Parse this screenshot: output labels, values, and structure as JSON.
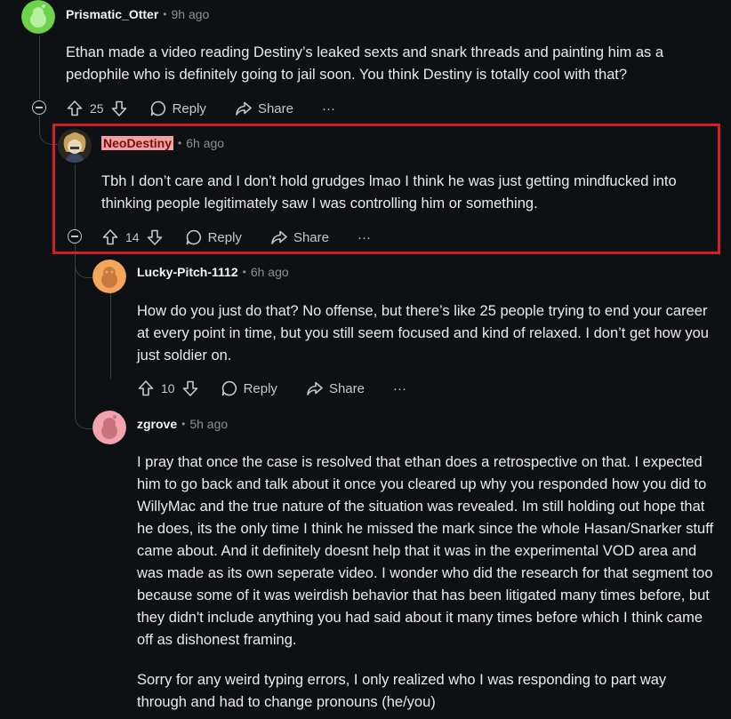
{
  "comments": [
    {
      "username": "Prismatic_Otter",
      "time": "9h ago",
      "body": [
        "Ethan made a video reading Destiny’s leaked sexts and snark threads and painting him as a pedophile who is definitely going to jail soon. You think Destiny is totally cool with that?"
      ],
      "votes": "25",
      "reply_label": "Reply",
      "share_label": "Share",
      "more_label": "···",
      "avatar_color": "#6cd34a"
    },
    {
      "username": "NeoDestiny",
      "time": "6h ago",
      "body": [
        "Tbh I don’t care and I don’t hold grudges lmao I think he was just getting mindfucked into thinking people legitimately saw I was controlling him or something."
      ],
      "votes": "14",
      "reply_label": "Reply",
      "share_label": "Share",
      "more_label": "···",
      "highlight_color": "#d41f1f"
    },
    {
      "username": "Lucky-Pitch-1112",
      "time": "6h ago",
      "body": [
        "How do you just do that? No offense, but there’s like 25 people trying to end your career at every point in time, but you still seem focused and kind of relaxed. I don’t get how you just soldier on."
      ],
      "votes": "10",
      "reply_label": "Reply",
      "share_label": "Share",
      "more_label": "···",
      "avatar_color": "#f5a65b"
    },
    {
      "username": "zgrove",
      "time": "5h ago",
      "body": [
        "I pray that once the case is resolved that ethan does a retrospective on that. I expected him to go back and talk about it once you cleared up why you responded how you did to WillyMac and the true nature of the situation was revealed. Im still holding out hope that he does, its the only time I think he missed the mark since the whole Hasan/Snarker stuff came about. And it definitely doesnt help that it was in the experimental VOD area and was made as its own seperate video. I wonder who did the research for that segment too because some of it was weirdish behavior that has been litigated many times before, but they didn't include anything you had said about it many times before which I think came off as dishonest framing.",
        "Sorry for any weird typing errors, I only realized who I was responding to part way through and had to change pronouns (he/you)"
      ],
      "avatar_color": "#f3a3ad"
    }
  ]
}
